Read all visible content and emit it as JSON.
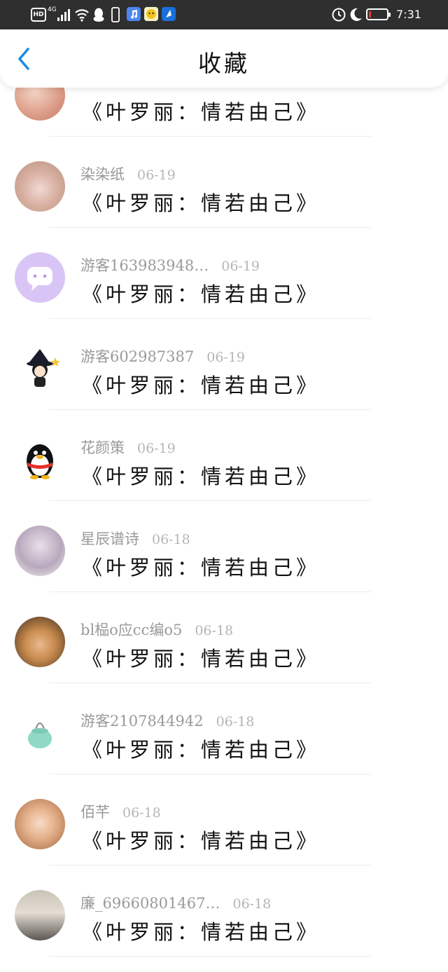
{
  "status_bar": {
    "hd": "HD",
    "network": "4G",
    "time": "7:31",
    "app_icons": [
      "music-app-icon",
      "chat-app-icon",
      "map-app-icon"
    ],
    "battery_color": "#e23b3b"
  },
  "header": {
    "title": "收藏",
    "back_icon": "chevron-left-icon",
    "accent": "#1a8ae6"
  },
  "favorites": [
    {
      "user": "",
      "date": "",
      "content": "《叶罗丽：情若由己》",
      "avatar": "pink-photo-avatar"
    },
    {
      "user": "染染纸",
      "date": "06-19",
      "content": "《叶罗丽：情若由己》",
      "avatar": "room-photo-avatar"
    },
    {
      "user": "游客163983948…",
      "date": "06-19",
      "content": "《叶罗丽：情若由己》",
      "avatar": "purple-chat-avatar"
    },
    {
      "user": "游客602987387",
      "date": "06-19",
      "content": "《叶罗丽：情若由己》",
      "avatar": "witch-avatar"
    },
    {
      "user": "花颜策",
      "date": "06-19",
      "content": "《叶罗丽：情若由己》",
      "avatar": "penguin-avatar"
    },
    {
      "user": "星辰谱诗",
      "date": "06-18",
      "content": "《叶罗丽：情若由己》",
      "avatar": "girl-hair-avatar"
    },
    {
      "user": "bl榀o应cc编o5",
      "date": "06-18",
      "content": "《叶罗丽：情若由己》",
      "avatar": "anime-boy-avatar"
    },
    {
      "user": "游客2107844942",
      "date": "06-18",
      "content": "《叶罗丽：情若由己》",
      "avatar": "green-bag-avatar"
    },
    {
      "user": "佰芊",
      "date": "06-18",
      "content": "《叶罗丽：情若由己》",
      "avatar": "painted-girl-avatar"
    },
    {
      "user": "廉_69660801467…",
      "date": "06-18",
      "content": "《叶罗丽：情若由己》",
      "avatar": "family-photo-avatar"
    }
  ]
}
